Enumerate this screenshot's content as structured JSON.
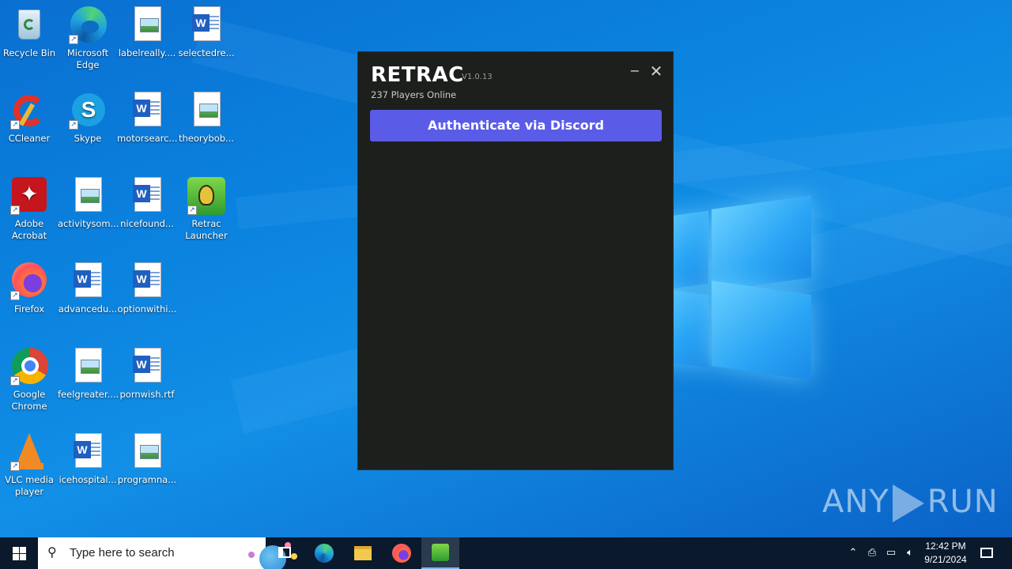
{
  "desktop": {
    "icons": [
      {
        "label": "Recycle Bin",
        "icon": "recycle-bin-icon"
      },
      {
        "label": "Microsoft Edge",
        "icon": "edge-icon"
      },
      {
        "label": "labelreally....",
        "icon": "image-file-icon"
      },
      {
        "label": "selectedre...",
        "icon": "word-file-icon"
      },
      {
        "label": "CCleaner",
        "icon": "ccleaner-icon"
      },
      {
        "label": "Skype",
        "icon": "skype-icon"
      },
      {
        "label": "motorsearc...",
        "icon": "word-file-icon"
      },
      {
        "label": "theorybob...",
        "icon": "image-file-icon"
      },
      {
        "label": "Adobe Acrobat",
        "icon": "acrobat-icon"
      },
      {
        "label": "activitysom...",
        "icon": "image-file-icon"
      },
      {
        "label": "nicefound...",
        "icon": "word-file-icon"
      },
      {
        "label": "Retrac Launcher",
        "icon": "retrac-launcher-icon"
      },
      {
        "label": "Firefox",
        "icon": "firefox-icon"
      },
      {
        "label": "advancedu...",
        "icon": "word-file-icon"
      },
      {
        "label": "optionwithi...",
        "icon": "word-file-icon"
      },
      {
        "label": "Google Chrome",
        "icon": "chrome-icon"
      },
      {
        "label": "feelgreater....",
        "icon": "image-file-icon"
      },
      {
        "label": "pornwish.rtf",
        "icon": "word-file-icon"
      },
      {
        "label": "VLC media player",
        "icon": "vlc-icon"
      },
      {
        "label": "icehospital...",
        "icon": "word-file-icon"
      },
      {
        "label": "programna...",
        "icon": "image-file-icon"
      }
    ]
  },
  "launcher": {
    "brand": "RETRAC",
    "version": "V1.0.13",
    "players_online": "237 Players Online",
    "minimize": "−",
    "close": "✕",
    "auth_button": "Authenticate via Discord",
    "accent": "#5a5ce8",
    "background": "#1d1f1d"
  },
  "watermark": {
    "left": "ANY",
    "right": "RUN"
  },
  "taskbar": {
    "search_placeholder": "Type here to search",
    "pinned": [
      "task-view-icon",
      "edge-icon",
      "file-explorer-icon",
      "firefox-icon",
      "retrac-launcher-icon"
    ],
    "active": "retrac-launcher-icon",
    "clock_time": "12:42 PM",
    "clock_date": "9/21/2024"
  }
}
